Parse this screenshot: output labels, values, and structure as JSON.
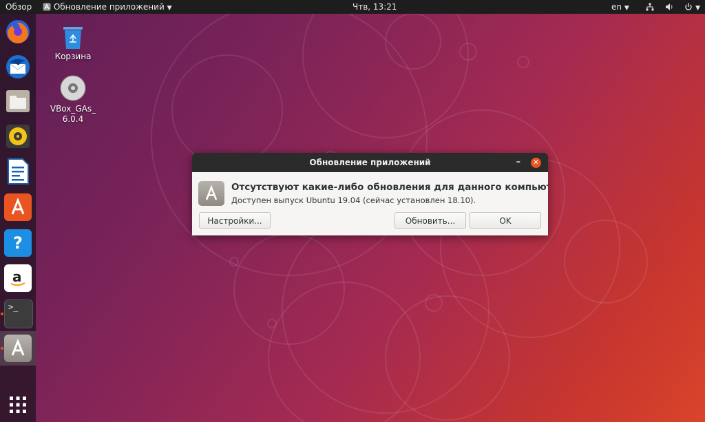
{
  "topbar": {
    "activities": "Обзор",
    "app_menu": "Обновление приложений",
    "clock": "Чтв, 13:21",
    "language": "en"
  },
  "dock": {
    "items": [
      {
        "name": "firefox"
      },
      {
        "name": "thunderbird"
      },
      {
        "name": "files"
      },
      {
        "name": "rhythmbox"
      },
      {
        "name": "libreoffice-writer"
      },
      {
        "name": "ubuntu-software"
      },
      {
        "name": "help"
      },
      {
        "name": "amazon"
      },
      {
        "name": "terminal",
        "running": true
      },
      {
        "name": "software-updater",
        "running": true,
        "active": true
      },
      {
        "name": "show-applications"
      }
    ]
  },
  "desktop": {
    "trash_label": "Корзина",
    "disc_label_line1": "VBox_GAs_",
    "disc_label_line2": "6.0.4"
  },
  "dialog": {
    "title": "Обновление приложений",
    "message": "Отсутствуют какие-либо обновления для данного компьютера.",
    "detail": "Доступен выпуск Ubuntu 19.04 (сейчас установлен 18.10).",
    "settings_label": "Настройки...",
    "update_label": "Обновить...",
    "ok_label": "OK"
  },
  "colors": {
    "accent": "#e95420",
    "topbar_bg": "#1d1d1d",
    "dialog_titlebar": "#2b2b2b"
  }
}
